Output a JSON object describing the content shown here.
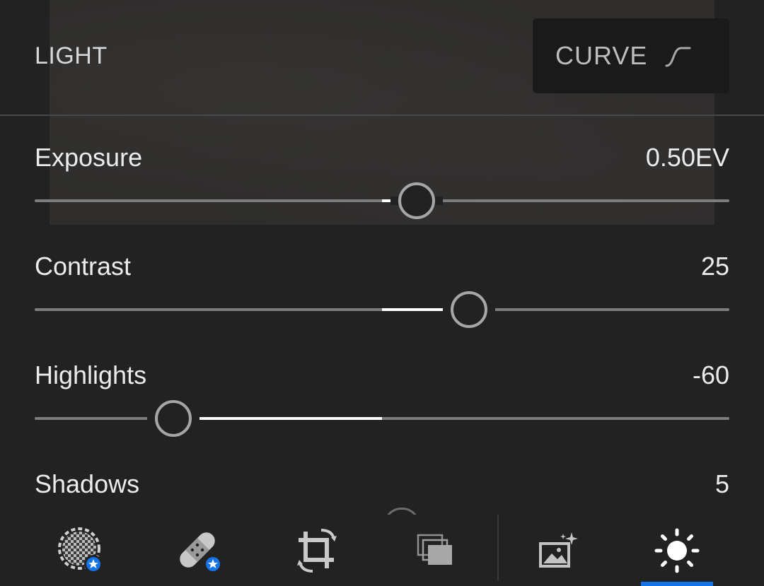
{
  "panel": {
    "title": "LIGHT",
    "curve_button_label": "CURVE"
  },
  "sliders": [
    {
      "label": "Exposure",
      "value": "0.50EV",
      "position": 0.55
    },
    {
      "label": "Contrast",
      "value": "25",
      "position": 0.625
    },
    {
      "label": "Highlights",
      "value": "-60",
      "position": 0.2
    },
    {
      "label": "Shadows",
      "value": "5",
      "position": 0.525
    }
  ],
  "toolbar": {
    "items": [
      {
        "icon": "selective-mask-icon",
        "premium": true
      },
      {
        "icon": "healing-bandage-icon",
        "premium": true
      },
      {
        "icon": "crop-rotate-icon",
        "premium": false
      },
      {
        "icon": "presets-icon",
        "premium": false
      },
      {
        "icon": "auto-enhance-icon",
        "premium": false
      },
      {
        "icon": "light-sun-icon",
        "premium": false,
        "active": true
      }
    ]
  },
  "colors": {
    "background": "#232223",
    "accent": "#1473e6",
    "track": "#7d7c7c",
    "fill": "#ffffff"
  }
}
